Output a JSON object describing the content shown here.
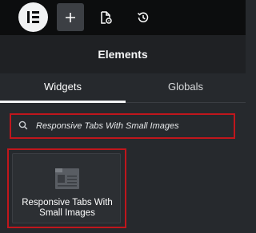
{
  "toolbar": {
    "logo_icon": "elementor-logo-icon",
    "add_icon": "plus-icon",
    "page_settings_icon": "document-settings-icon",
    "history_icon": "history-icon"
  },
  "panel": {
    "title": "Elements"
  },
  "tabs": [
    {
      "label": "Widgets",
      "active": true
    },
    {
      "label": "Globals",
      "active": false
    }
  ],
  "search": {
    "value": "Responsive Tabs With Small Images",
    "icon": "search-icon"
  },
  "results": [
    {
      "label": "Responsive Tabs With Small Images",
      "icon": "widget-tabs-icon"
    }
  ],
  "colors": {
    "topbar": "#0c0d0e",
    "highlight": "#c0161c",
    "panel_bg": "#26292d"
  }
}
